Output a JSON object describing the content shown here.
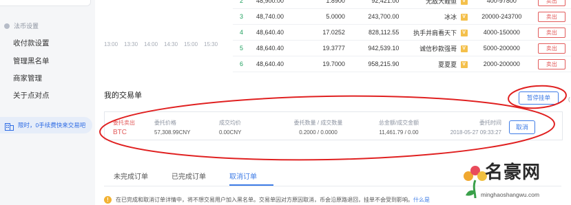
{
  "sidebar": {
    "section_title": "法币设置",
    "items": [
      "收付款设置",
      "管理黑名单",
      "商家管理",
      "关于点对点"
    ],
    "promo": "限时，0手续费快来交易吧"
  },
  "chart_axis": [
    "13:00",
    "13:30",
    "14:00",
    "14:30",
    "15:00",
    "15:30"
  ],
  "order_book": [
    {
      "idx": "2",
      "price": "48,900.00",
      "amount": "1.8900",
      "total": "92,421.00",
      "name": "无敌大鲤鱼",
      "v": "V",
      "limit": "400-97800",
      "action": "卖出"
    },
    {
      "idx": "3",
      "price": "48,740.00",
      "amount": "5.0000",
      "total": "243,700.00",
      "name": "冰冰",
      "v": "V",
      "limit": "20000-243700",
      "action": "卖出"
    },
    {
      "idx": "4",
      "price": "48,640.40",
      "amount": "17.0252",
      "total": "828,112.55",
      "name": "执手并肩看天下",
      "v": "V",
      "limit": "4000-150000",
      "action": "卖出"
    },
    {
      "idx": "5",
      "price": "48,640.40",
      "amount": "19.3777",
      "total": "942,539.10",
      "name": "诚信秒款强哥",
      "v": "V",
      "limit": "5000-200000",
      "action": "卖出"
    },
    {
      "idx": "6",
      "price": "48,640.40",
      "amount": "19.7000",
      "total": "958,215.90",
      "name": "夏夏夏",
      "v": "V",
      "limit": "2000-200000",
      "action": "卖出"
    }
  ],
  "my_orders": {
    "title": "我的交易单",
    "pause_button": "暂停挂单",
    "order": {
      "type_label": "委托卖出",
      "coin": "BTC",
      "price_label": "委托价格",
      "price": "57,308.99CNY",
      "avg_label": "成交均价",
      "avg": "0.00CNY",
      "qty_label": "委托数量 / 成交数量",
      "qty": "0.2000 / 0.0000",
      "total_label": "总金额/成交金额",
      "total": "11,461.79 / 0.00",
      "time_label": "委托时间",
      "time": "2018-05-27 09:33:27",
      "cancel": "取消"
    }
  },
  "tabs": [
    "未完成订单",
    "已完成订单",
    "取消订单"
  ],
  "notice": {
    "text": "在已完成和取消订单详情中，将不想交易用户加入黑名单。交易单因对方原因取消，币会沿原路退回，挂单不会受到影响。",
    "link": "什么是"
  },
  "watermark": {
    "title": "名豪网",
    "url": "minghaoshangwu.com"
  },
  "colors": {
    "accent": "#3d7be6",
    "sell": "#e25b5b",
    "annotation": "#e02020"
  }
}
